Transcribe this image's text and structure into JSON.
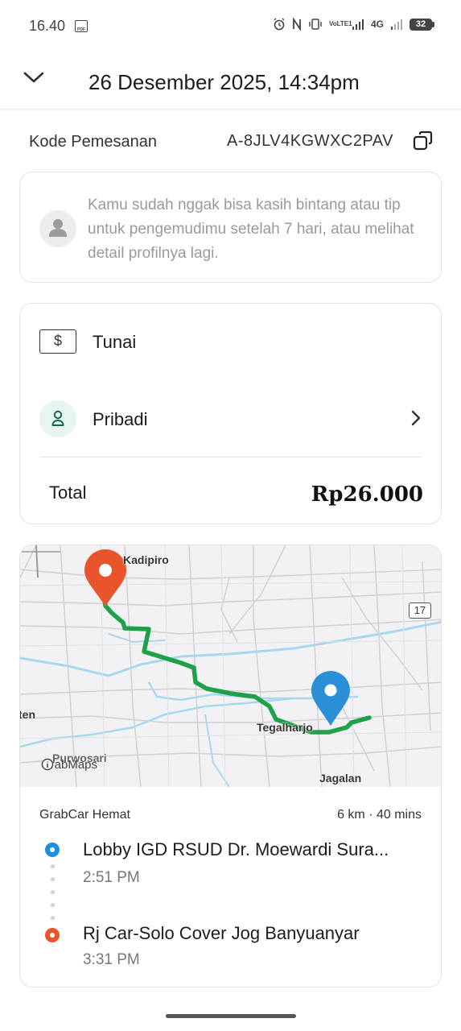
{
  "status_bar": {
    "time": "16.40",
    "network": "4G",
    "volte": "VoLTE1",
    "battery": "32"
  },
  "header": {
    "title": "26 Desember 2025, 14:34pm"
  },
  "booking": {
    "label": "Kode Pemesanan",
    "code": "A-8JLV4KGWXC2PAV"
  },
  "driver_notice": {
    "text": "Kamu sudah nggak bisa kasih bintang atau tip untuk pengemudimu setelah 7 hari, atau melihat detail profilnya lagi."
  },
  "payment": {
    "method_icon": "$",
    "method": "Tunai",
    "profile": "Pribadi",
    "total_label": "Total",
    "total_value": "Rp26.000"
  },
  "map": {
    "labels": {
      "kadipiro": "Kadipiro",
      "tegalharjo": "Tegalharjo",
      "jagalan": "Jagalan",
      "west_edge": "ten",
      "sw": "Purwosari"
    },
    "road_number": "17",
    "brand": "GrabMaps",
    "route_color": "#1fa149",
    "pickup_pin_color": "#2b8fd8",
    "drop_pin_color": "#e8552d"
  },
  "trip": {
    "service": "GrabCar Hemat",
    "meta": "6 km · 40 mins",
    "pickup_name": "Lobby IGD RSUD Dr. Moewardi Sura...",
    "pickup_time": "2:51 PM",
    "drop_name": "Rj Car-Solo Cover Jog Banyuanyar",
    "drop_time": "3:31 PM"
  }
}
